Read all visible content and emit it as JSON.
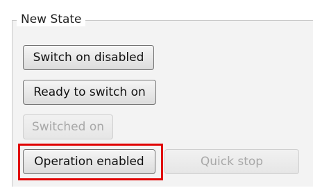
{
  "group": {
    "title": "New State"
  },
  "buttons": {
    "switch_on_disabled": "Switch on disabled",
    "ready_to_switch_on": "Ready to switch on",
    "switched_on": "Switched on",
    "operation_enabled": "Operation enabled",
    "quick_stop": "Quick stop"
  },
  "colors": {
    "highlight": "#e00000",
    "group_border": "#c9c9c9",
    "disabled_text": "#a8a8a8"
  }
}
